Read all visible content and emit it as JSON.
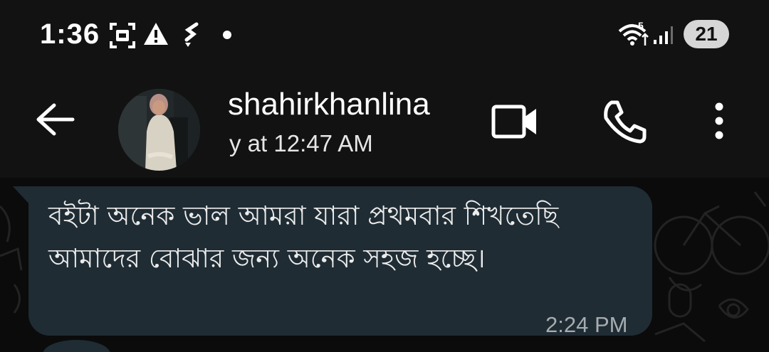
{
  "status_bar": {
    "time": "1:36",
    "battery": "21",
    "icons": [
      "screenshot-icon",
      "alert-icon",
      "sync-icon",
      "notification-dot",
      "wifi-icon",
      "signal-icon",
      "battery-icon"
    ],
    "wifi_label": "5"
  },
  "header": {
    "contact_name": "shahirkhanlina",
    "last_seen": "y at 12:47 AM",
    "icons": [
      "back-arrow-icon",
      "video-call-icon",
      "voice-call-icon",
      "more-options-icon"
    ]
  },
  "message": {
    "text": "বইটা অনেক ভাল আমরা যারা প্রথমবার শিখতেছি আমাদের বোঝার জন্য অনেক সহজ হচ্ছে।",
    "time": "2:24 PM",
    "direction": "incoming"
  },
  "colors": {
    "background": "#0b0b0b",
    "header": "#121212",
    "incoming_bubble": "#1f2c34",
    "meta_text": "#a6acaf"
  }
}
